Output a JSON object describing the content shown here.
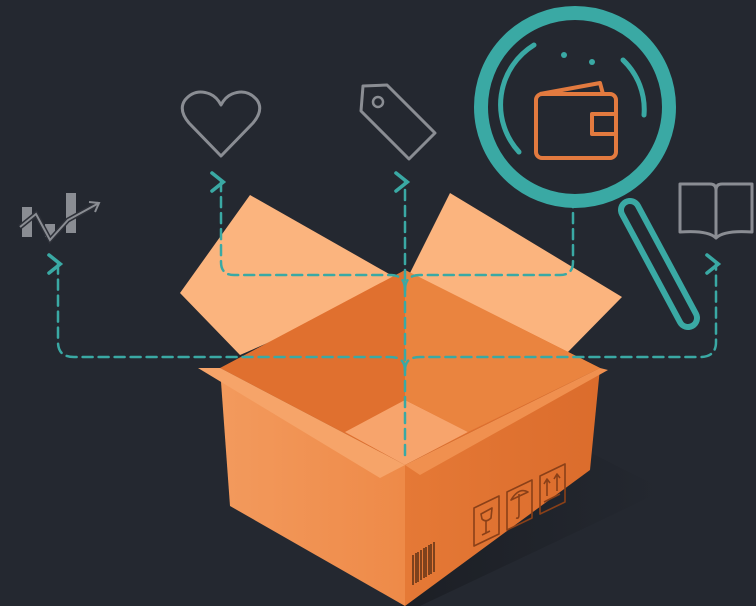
{
  "scene": {
    "background": "#242830",
    "subject": "open-cardboard-box",
    "connector_style": "dashed-arrows",
    "icons": [
      {
        "name": "growth-chart-icon",
        "color": "#8a8d93"
      },
      {
        "name": "heart-icon",
        "color": "#8a8d93"
      },
      {
        "name": "price-tag-icon",
        "color": "#8a8d93"
      },
      {
        "name": "wallet-in-magnifier-icon",
        "color": "#3aa9a4",
        "accent": "#e27a3f"
      },
      {
        "name": "open-book-icon",
        "color": "#8a8d93"
      }
    ],
    "box_labels": [
      {
        "name": "fragile-glass-icon"
      },
      {
        "name": "keep-dry-umbrella-icon"
      },
      {
        "name": "this-way-up-icon"
      },
      {
        "name": "barcode"
      }
    ],
    "colors": {
      "box_front_left": "#f19355",
      "box_front_right": "#e47634",
      "box_inside": "#db6b2e",
      "box_flap": "#fbb37d",
      "connector": "#3aa9a4",
      "icon_gray": "#8a8d93"
    }
  }
}
